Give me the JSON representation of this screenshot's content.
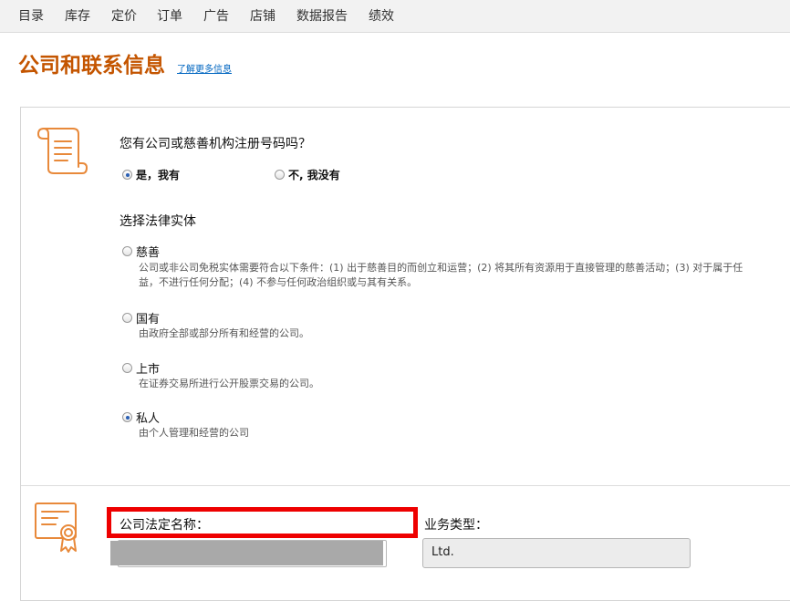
{
  "nav": {
    "items": [
      "目录",
      "库存",
      "定价",
      "订单",
      "广告",
      "店铺",
      "数据报告",
      "绩效"
    ]
  },
  "page": {
    "title": "公司和联系信息",
    "learn_more": "了解更多信息"
  },
  "registration": {
    "question": "您有公司或慈善机构注册号码吗？",
    "options": [
      {
        "label": "是，我有",
        "checked": true
      },
      {
        "label": "不, 我没有",
        "checked": false
      }
    ]
  },
  "legal_entity": {
    "heading": "选择法律实体",
    "options": [
      {
        "label": "慈善",
        "checked": false,
        "desc_lines": [
          "公司或非公司免税实体需要符合以下条件：(1) 出于慈善目的而创立和运营；(2) 将其所有资源用于直接管理的慈善活动；(3) 对于属于任",
          "益，不进行任何分配；(4) 不参与任何政治组织或与其有关系。"
        ]
      },
      {
        "label": "国有",
        "checked": false,
        "desc_lines": [
          "由政府全部或部分所有和经营的公司。"
        ]
      },
      {
        "label": "上市",
        "checked": false,
        "desc_lines": [
          "在证券交易所进行公开股票交易的公司。"
        ]
      },
      {
        "label": "私人",
        "checked": true,
        "desc_lines": [
          "由个人管理和经营的公司"
        ]
      }
    ]
  },
  "company": {
    "legal_name_label": "公司法定名称：",
    "legal_name_value": "",
    "business_type_label": "业务类型：",
    "business_type_value": "Ltd."
  },
  "colors": {
    "title_orange": "#c45500",
    "link_blue": "#0066c0",
    "highlight_red": "#ee0000",
    "icon_orange": "#e8893a"
  },
  "icons": {
    "document_icon": "scroll-document-icon",
    "certificate_icon": "certificate-icon"
  }
}
